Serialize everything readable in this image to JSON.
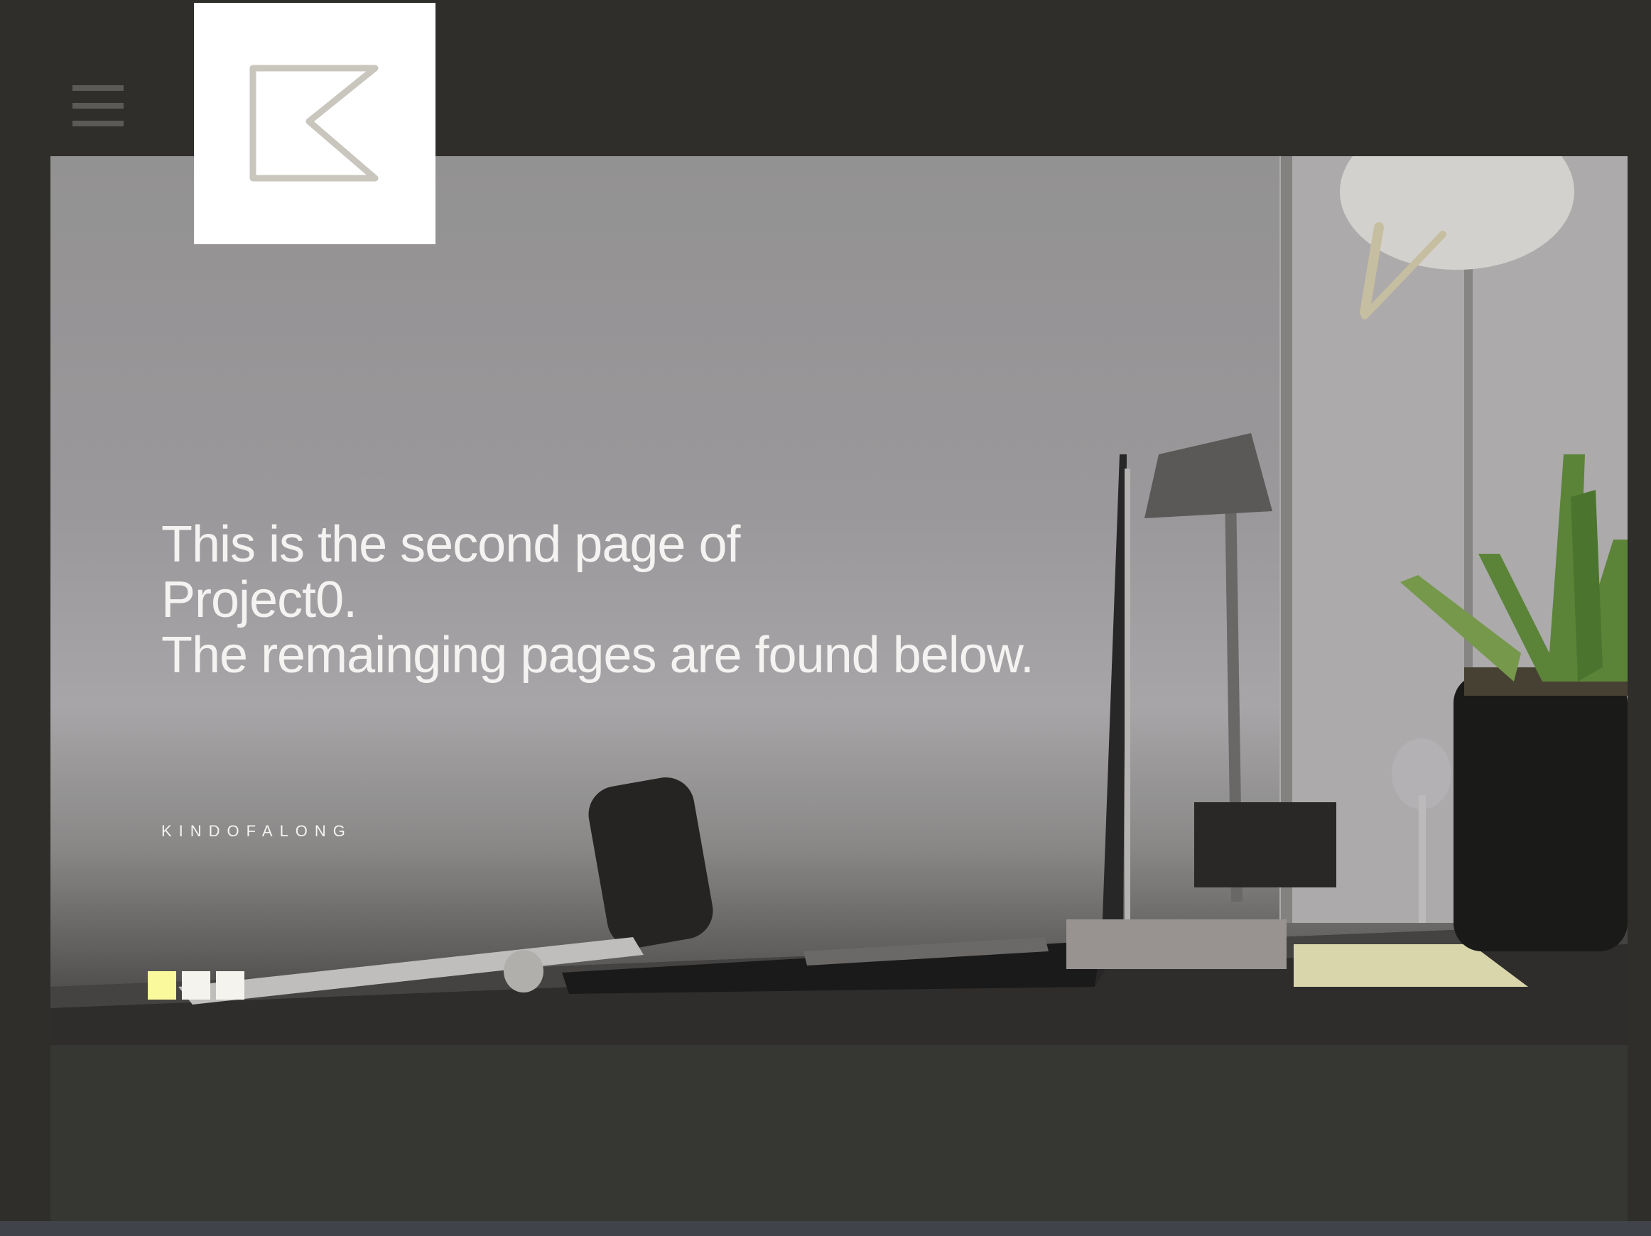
{
  "brand": {
    "logo_alt": "KINDOFALONG logo"
  },
  "hero": {
    "headline_lines": [
      "This is the second page of",
      "Project0.",
      "The remainging pages are found below."
    ],
    "tagline": "KINDOFALONG",
    "image_description": "A desk with a laptop, keyboard, desk lamp and potted plant",
    "slides": {
      "count": 3,
      "active_index": 0
    }
  },
  "content": {
    "partial_text": "… … … … … … … … … … … … … … …"
  },
  "colors": {
    "page_background": "#2f2e2b",
    "hero_text": "#f4f3f1",
    "active_dot": "#fafa9c",
    "inactive_dot": "#f5f3ee",
    "logo_mark": "#c9c6be",
    "lower_section": "#363633"
  },
  "icons": {
    "menu": "hamburger-icon",
    "logo": "k-flag-logo"
  }
}
